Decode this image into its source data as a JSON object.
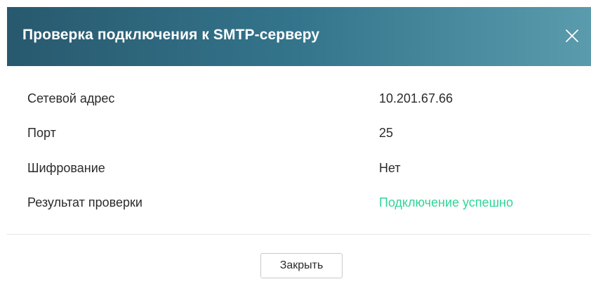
{
  "dialog": {
    "title": "Проверка подключения к SMTP-серверу",
    "close_icon": "close-icon",
    "header_gradient": [
      "#28596e",
      "#34758c",
      "#5a9bad"
    ]
  },
  "details": [
    {
      "label": "Сетевой адрес",
      "value": "10.201.67.66"
    },
    {
      "label": "Порт",
      "value": "25"
    },
    {
      "label": "Шифрование",
      "value": "Нет"
    },
    {
      "label": "Результат проверки",
      "value": "Подключение успешно"
    }
  ],
  "colors": {
    "success": "#2fd598",
    "text": "#2b2b2b"
  },
  "footer": {
    "close_label": "Закрыть"
  }
}
